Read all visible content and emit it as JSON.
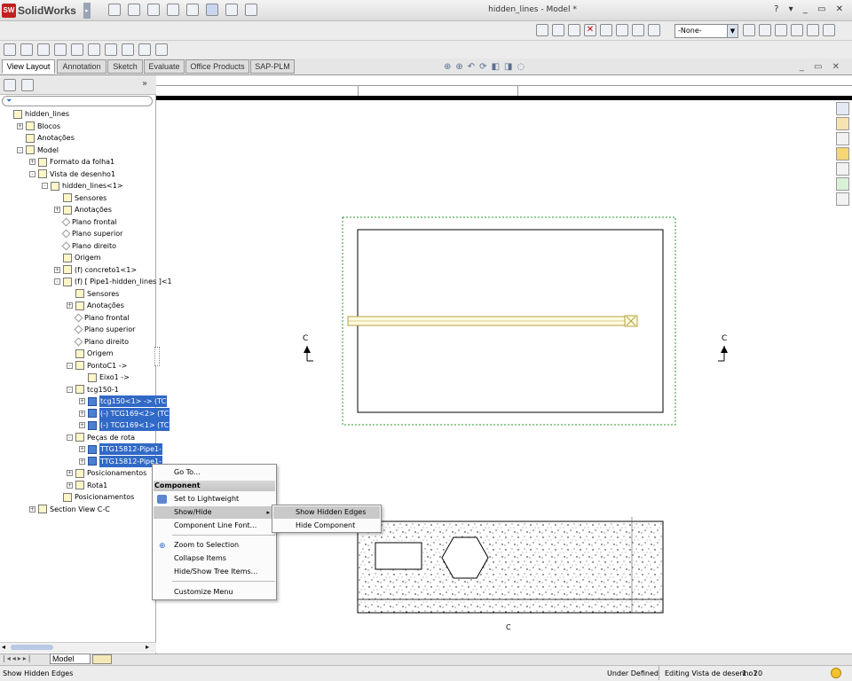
{
  "app": {
    "logo_text": "SolidWorks",
    "window_title": "hidden_lines - Model *",
    "window_controls": "? ▾ _ ▭ ✕"
  },
  "toolbar": {
    "configuration_value": "-None-"
  },
  "tabs": [
    {
      "label": "View Layout",
      "active": true
    },
    {
      "label": "Annotation",
      "active": false
    },
    {
      "label": "Sketch",
      "active": false
    },
    {
      "label": "Evaluate",
      "active": false
    },
    {
      "label": "Office Products",
      "active": false
    },
    {
      "label": "SAP-PLM",
      "active": false
    }
  ],
  "tree": [
    {
      "label": "hidden_lines",
      "level": 0,
      "icon": "drawing-icon"
    },
    {
      "label": "Blocos",
      "level": 1,
      "icon": "blocks-icon",
      "expander": "+"
    },
    {
      "label": "Anotações",
      "level": 1,
      "icon": "annotation-icon"
    },
    {
      "label": "Model",
      "level": 1,
      "icon": "sheet-icon",
      "expander": "-"
    },
    {
      "label": "Formato da folha1",
      "level": 2,
      "icon": "sheet-format-icon",
      "expander": "+"
    },
    {
      "label": "Vista de desenho1",
      "level": 2,
      "icon": "drawing-view-icon",
      "expander": "-"
    },
    {
      "label": "hidden_lines<1>",
      "level": 3,
      "icon": "assembly-icon",
      "expander": "-"
    },
    {
      "label": "Sensores",
      "level": 4,
      "icon": "sensor-icon"
    },
    {
      "label": "Anotações",
      "level": 4,
      "icon": "annotation-icon",
      "expander": "+"
    },
    {
      "label": "Plano frontal",
      "level": 4,
      "icon": "plane-icon"
    },
    {
      "label": "Plano superior",
      "level": 4,
      "icon": "plane-icon"
    },
    {
      "label": "Plano direito",
      "level": 4,
      "icon": "plane-icon"
    },
    {
      "label": "Origem",
      "level": 4,
      "icon": "origin-icon"
    },
    {
      "label": "(f) concreto1<1>",
      "level": 4,
      "icon": "part-icon",
      "expander": "+"
    },
    {
      "label": "(f) [ Pipe1-hidden_lines ]<1",
      "level": 4,
      "icon": "assembly-icon",
      "expander": "-"
    },
    {
      "label": "Sensores",
      "level": 5,
      "icon": "sensor-icon"
    },
    {
      "label": "Anotações",
      "level": 5,
      "icon": "annotation-icon",
      "expander": "+"
    },
    {
      "label": "Plano frontal",
      "level": 5,
      "icon": "plane-icon"
    },
    {
      "label": "Plano superior",
      "level": 5,
      "icon": "plane-icon"
    },
    {
      "label": "Plano direito",
      "level": 5,
      "icon": "plane-icon"
    },
    {
      "label": "Origem",
      "level": 5,
      "icon": "origin-icon"
    },
    {
      "label": "PontoC1 ->",
      "level": 5,
      "icon": "point-icon",
      "expander": "-"
    },
    {
      "label": "Eixo1 ->",
      "level": 6,
      "icon": "axis-icon"
    },
    {
      "label": "tcg150-1",
      "level": 5,
      "icon": "folder-icon",
      "expander": "-"
    },
    {
      "label": "tcg150<1> -> (TC",
      "level": 6,
      "icon": "component-icon",
      "expander": "+",
      "selected": true
    },
    {
      "label": "(-) TCG169<2> (TC",
      "level": 6,
      "icon": "component-icon",
      "expander": "+",
      "selected": true
    },
    {
      "label": "(-) TCG169<1> (TC",
      "level": 6,
      "icon": "component-icon",
      "expander": "+",
      "selected": true
    },
    {
      "label": "Peças de rota",
      "level": 5,
      "icon": "folder-icon",
      "expander": "-"
    },
    {
      "label": "TTG15812-Pipe1-",
      "level": 6,
      "icon": "component-icon",
      "expander": "+",
      "selected": true
    },
    {
      "label": "TTG15812-Pipe1-",
      "level": 6,
      "icon": "component-icon",
      "expander": "+",
      "selected": true
    },
    {
      "label": "Posicionamentos",
      "level": 5,
      "icon": "mates-icon",
      "expander": "+"
    },
    {
      "label": "Rota1",
      "level": 5,
      "icon": "route-icon",
      "expander": "+"
    },
    {
      "label": "Posicionamentos",
      "level": 4,
      "icon": "mates-icon"
    },
    {
      "label": "Section View C-C",
      "level": 2,
      "icon": "section-view-icon",
      "expander": "+"
    }
  ],
  "bottom_tabs": {
    "model_label": "Model"
  },
  "drawing": {
    "section_label_left": "C",
    "section_label_right": "C",
    "section_view_caption": "C"
  },
  "context_menu": {
    "goto": "Go To...",
    "header": "Component",
    "lightweight": "Set to Lightweight",
    "show_hide": "Show/Hide",
    "line_font": "Component Line Font...",
    "zoom_selection": "Zoom to Selection",
    "collapse": "Collapse Items",
    "hide_show_tree": "Hide/Show Tree Items...",
    "customize": "Customize Menu"
  },
  "submenu": {
    "show_hidden": "Show Hidden Edges",
    "hide_component": "Hide Component"
  },
  "status": {
    "message": "Show Hidden Edges",
    "state": "Under Defined",
    "editing": "Editing Vista de desenho1",
    "scale": "1 : 20"
  }
}
